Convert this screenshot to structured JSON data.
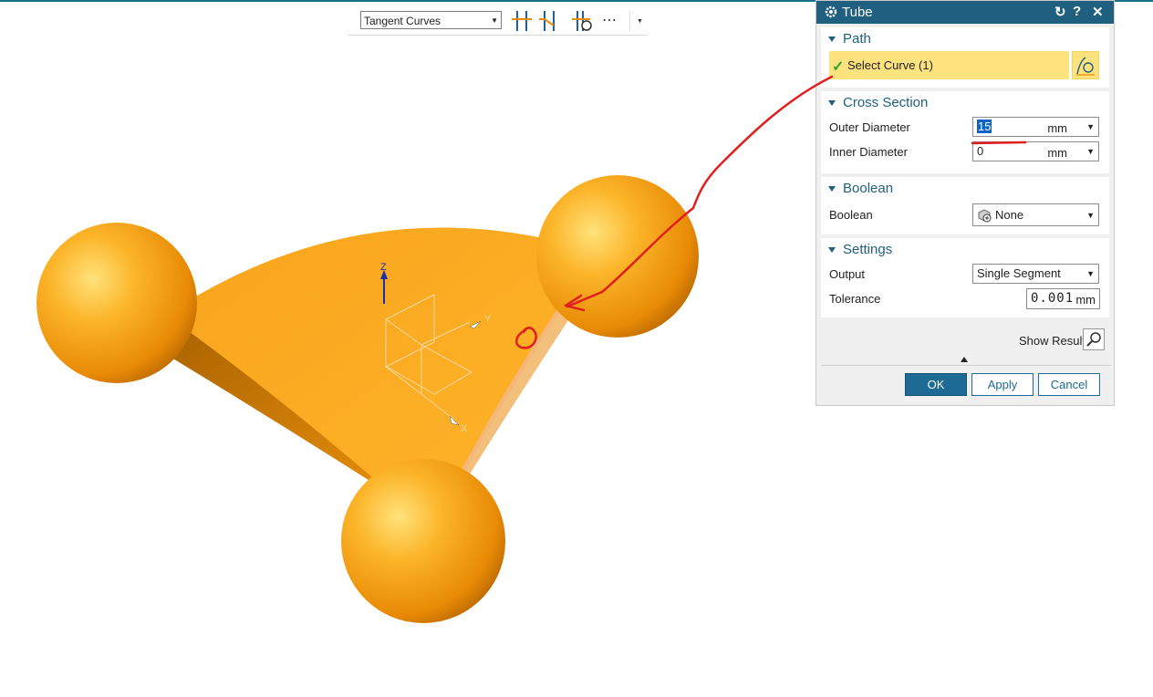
{
  "toolbar": {
    "filter_value": "Tangent Curves",
    "more_label": "⋯"
  },
  "viewport": {
    "axis_z": "Z",
    "axis_y": "Y",
    "axis_x": "X",
    "colors": {
      "model": "#f5a623",
      "annotation": "#e0201e"
    }
  },
  "dialog": {
    "title": "Tube",
    "path": {
      "heading": "Path",
      "select_curve": "Select Curve (1)"
    },
    "cross_section": {
      "heading": "Cross Section",
      "outer_label": "Outer Diameter",
      "outer_value": "15",
      "outer_unit": "mm",
      "inner_label": "Inner Diameter",
      "inner_value": "0",
      "inner_unit": "mm"
    },
    "boolean": {
      "heading": "Boolean",
      "label": "Boolean",
      "value": "None"
    },
    "settings": {
      "heading": "Settings",
      "output_label": "Output",
      "output_value": "Single Segment",
      "tolerance_label": "Tolerance",
      "tolerance_value": "0.001",
      "tolerance_unit": "mm"
    },
    "show_result": "Show Result",
    "ok": "OK",
    "apply": "Apply",
    "cancel": "Cancel"
  }
}
